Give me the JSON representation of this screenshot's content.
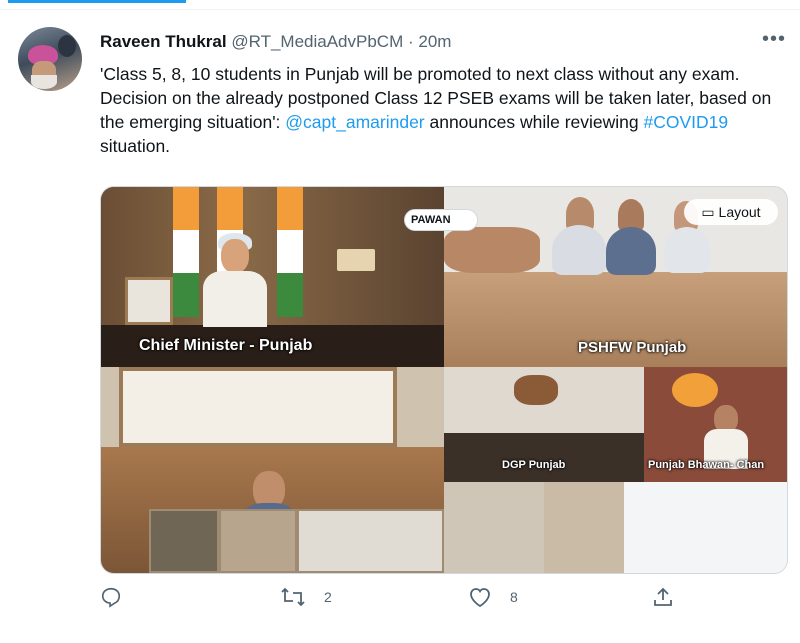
{
  "tweet": {
    "author_name": "Raveen Thukral",
    "author_handle": "@RT_MediaAdvPbCM",
    "separator": "·",
    "time": "20m",
    "more_icon": "more-horizontal-icon",
    "text_part1": "'Class  5, 8, 10 students in Punjab will be promoted to  next class without any exam. Decision on the already postponed Class 12 PSEB exams will be taken later, based on the emerging situation': ",
    "mention": "@capt_amarinder",
    "text_part2": " announces while reviewing ",
    "hashtag": "#COVID19",
    "text_part3": " situation."
  },
  "media": {
    "tiles": [
      {
        "caption": "Chief Minister - Punjab"
      },
      {
        "caption": "PSHFW Punjab"
      },
      {
        "caption": "DGP Punjab"
      },
      {
        "caption": "Punjab Bhawan- Chan"
      }
    ],
    "participant_badge": "PAWAN",
    "layout_button": "Layout",
    "layout_icon": "layout-icon"
  },
  "actions": {
    "reply_icon": "reply-icon",
    "reply_count": "",
    "retweet_icon": "retweet-icon",
    "retweet_count": "2",
    "like_icon": "heart-icon",
    "like_count": "8",
    "share_icon": "share-icon"
  },
  "colors": {
    "accent": "#1d9bf0",
    "text": "#0f1419",
    "muted": "#536471"
  }
}
